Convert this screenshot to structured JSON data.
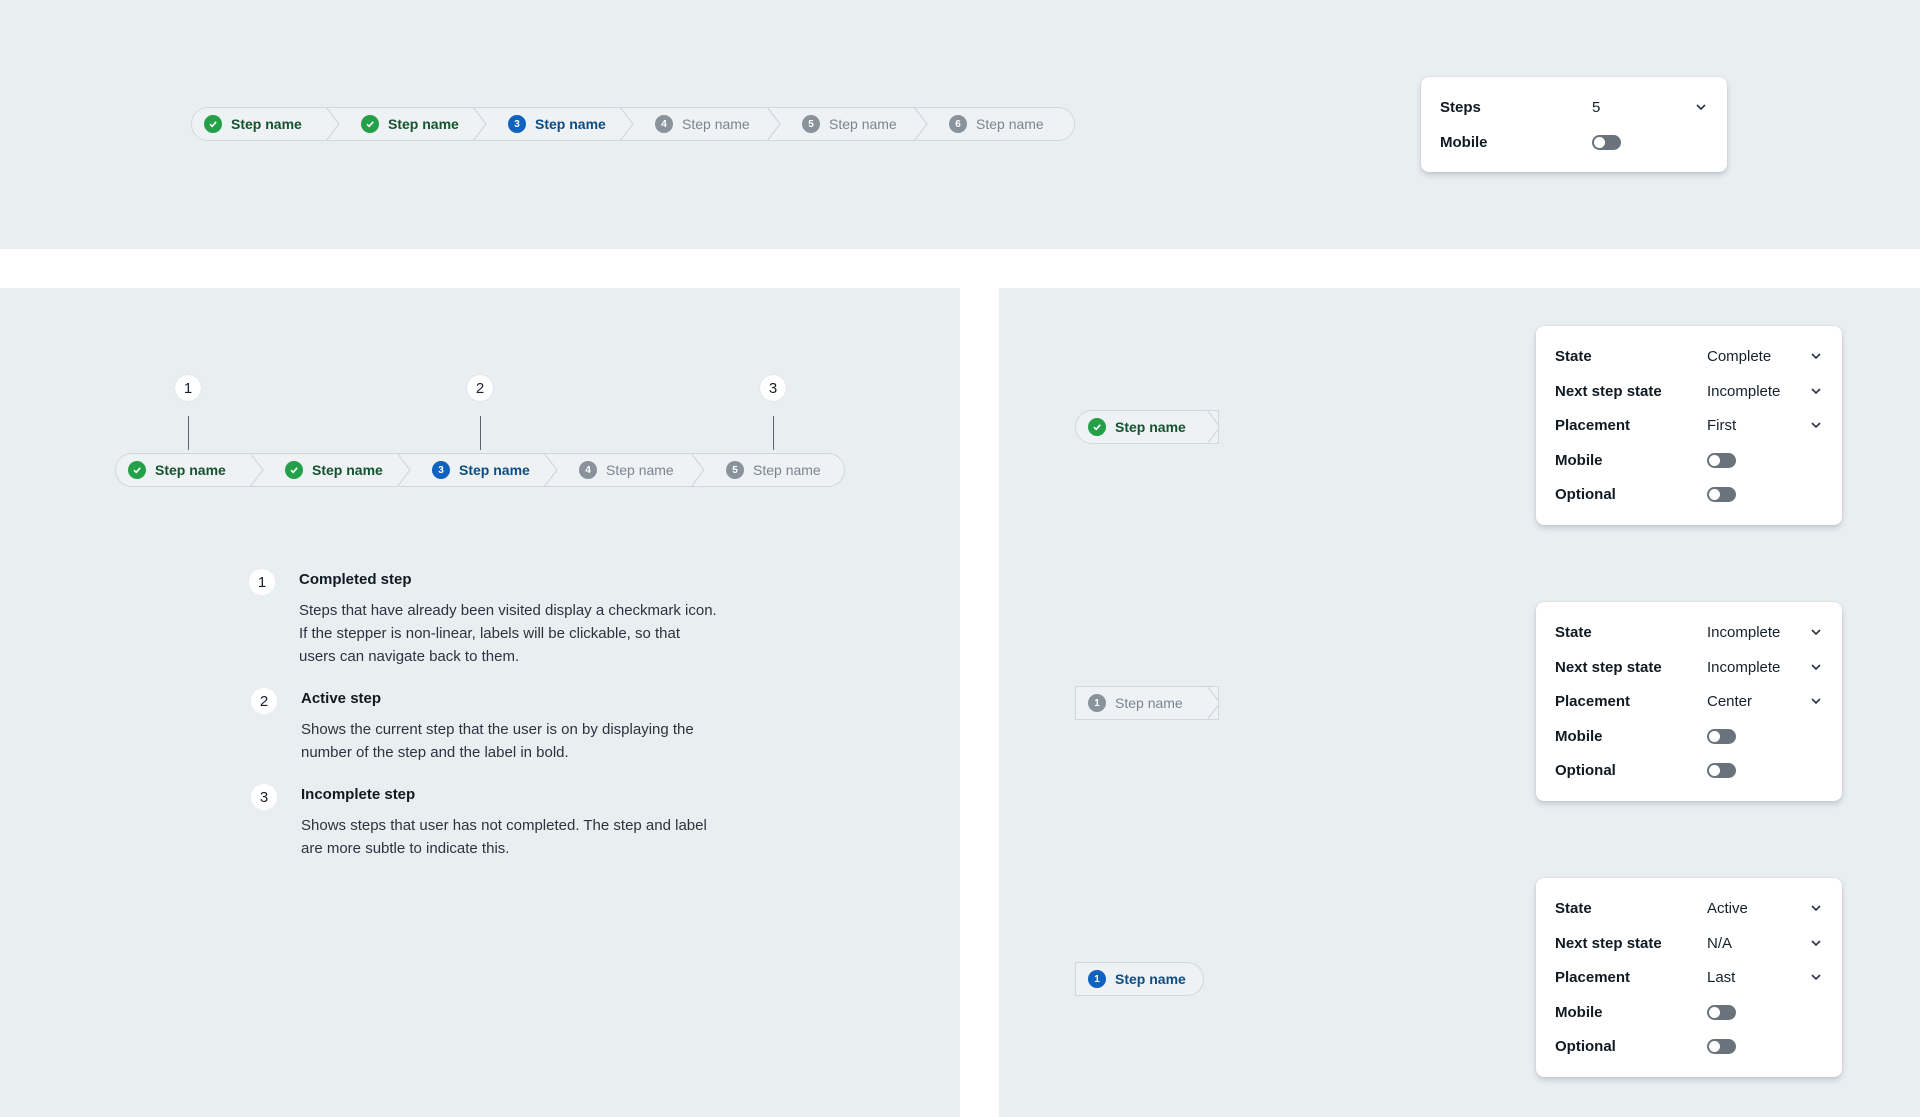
{
  "top_stepper": {
    "steps": [
      {
        "label": "Step name",
        "state": "complete",
        "number": "1"
      },
      {
        "label": "Step name",
        "state": "complete",
        "number": "2"
      },
      {
        "label": "Step name",
        "state": "active",
        "number": "3"
      },
      {
        "label": "Step name",
        "state": "incomplete",
        "number": "4"
      },
      {
        "label": "Step name",
        "state": "incomplete",
        "number": "5"
      },
      {
        "label": "Step name",
        "state": "incomplete",
        "number": "6"
      }
    ]
  },
  "top_controls": {
    "steps_label": "Steps",
    "steps_value": "5",
    "mobile_label": "Mobile",
    "mobile_on": false
  },
  "anatomy_stepper": {
    "steps": [
      {
        "label": "Step name",
        "state": "complete",
        "number": "1"
      },
      {
        "label": "Step name",
        "state": "complete",
        "number": "2"
      },
      {
        "label": "Step name",
        "state": "active",
        "number": "3"
      },
      {
        "label": "Step name",
        "state": "incomplete",
        "number": "4"
      },
      {
        "label": "Step name",
        "state": "incomplete",
        "number": "5"
      }
    ],
    "markers": [
      "1",
      "2",
      "3"
    ]
  },
  "descriptions": [
    {
      "number": "1",
      "title": "Completed step",
      "text": "Steps that have already been visited display a checkmark icon. If the stepper is non-linear, labels will be clickable, so that users can navigate back to them."
    },
    {
      "number": "2",
      "title": "Active step",
      "text": "Shows the current step that the user is on by displaying the number of the step and the label in bold."
    },
    {
      "number": "3",
      "title": "Incomplete step",
      "text": "Shows steps that user has not completed. The step and label are more subtle to indicate this."
    }
  ],
  "variants": [
    {
      "step": {
        "label": "Step name",
        "state": "complete",
        "number": "1"
      },
      "props": {
        "state_label": "State",
        "state_value": "Complete",
        "next_label": "Next step state",
        "next_value": "Incomplete",
        "placement_label": "Placement",
        "placement_value": "First",
        "mobile_label": "Mobile",
        "mobile_on": false,
        "optional_label": "Optional",
        "optional_on": false
      }
    },
    {
      "step": {
        "label": "Step name",
        "state": "incomplete",
        "number": "1"
      },
      "props": {
        "state_label": "State",
        "state_value": "Incomplete",
        "next_label": "Next step state",
        "next_value": "Incomplete",
        "placement_label": "Placement",
        "placement_value": "Center",
        "mobile_label": "Mobile",
        "mobile_on": false,
        "optional_label": "Optional",
        "optional_on": false
      }
    },
    {
      "step": {
        "label": "Step name",
        "state": "active",
        "number": "1"
      },
      "props": {
        "state_label": "State",
        "state_value": "Active",
        "next_label": "Next step state",
        "next_value": "N/A",
        "placement_label": "Placement",
        "placement_value": "Last",
        "mobile_label": "Mobile",
        "mobile_on": false,
        "optional_label": "Optional",
        "optional_on": false
      }
    }
  ],
  "colors": {
    "panel_bg": "#e9eef1",
    "complete": "#24a148",
    "active": "#0f62c0",
    "incomplete": "#8a939b"
  }
}
